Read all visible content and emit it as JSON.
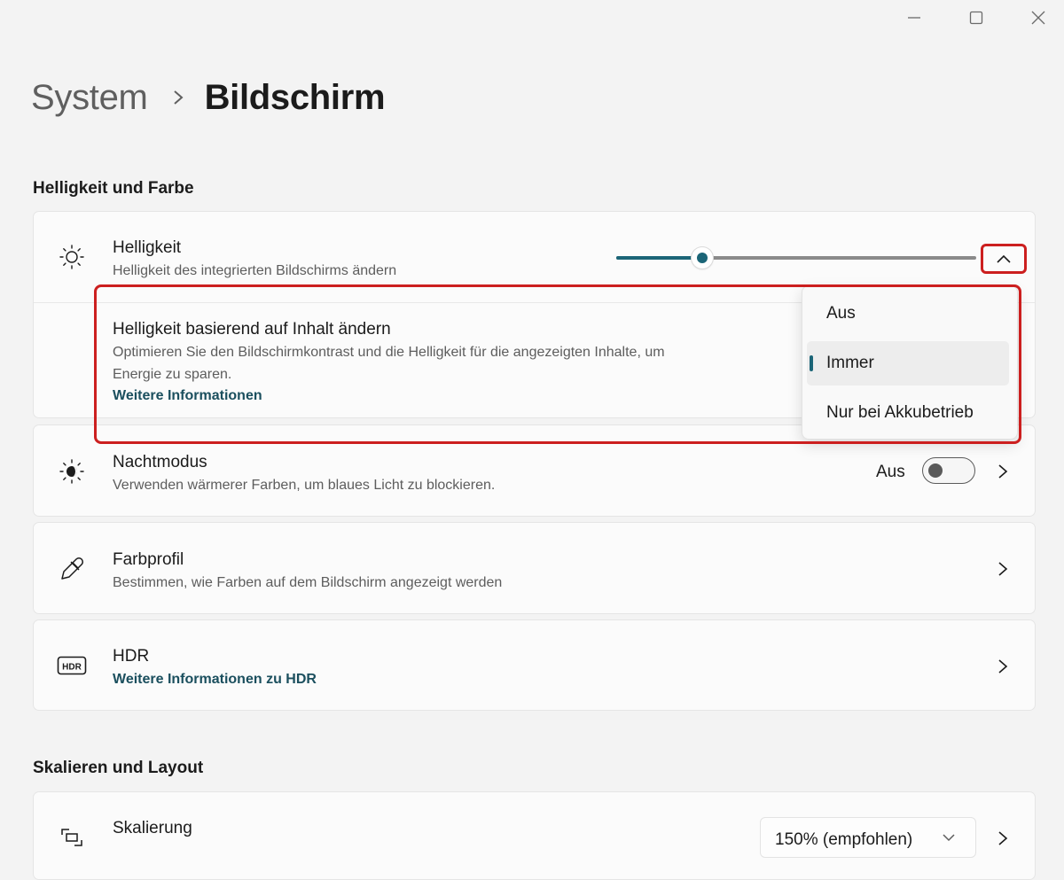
{
  "window": {
    "controls": [
      "minimize-icon",
      "maximize-icon",
      "close-icon"
    ]
  },
  "breadcrumb": {
    "parent": "System",
    "separator_icon": "chevron-right-icon",
    "current": "Bildschirm"
  },
  "sections": {
    "brightness_color": "Helligkeit und Farbe",
    "scale_layout": "Skalieren und Layout"
  },
  "brightness": {
    "icon": "sun-icon",
    "title": "Helligkeit",
    "subtitle": "Helligkeit des integrierten Bildschirms ändern",
    "value_fraction": 0.24,
    "expand_icon": "chevron-up-icon",
    "content_adaptive": {
      "title": "Helligkeit basierend auf Inhalt ändern",
      "description_line1": "Optimieren Sie den Bildschirmkontrast und die Helligkeit für die angezeigten Inhalte, um",
      "description_line2": "Energie zu sparen.",
      "link": "Weitere Informationen"
    },
    "dropdown": {
      "options": [
        "Aus",
        "Immer",
        "Nur bei Akkubetrieb"
      ],
      "selected": "Immer"
    }
  },
  "night_mode": {
    "icon": "night-light-icon",
    "title": "Nachtmodus",
    "subtitle": "Verwenden wärmerer Farben, um blaues Licht zu blockieren.",
    "toggle_label": "Aus",
    "toggle_on": false
  },
  "color_profile": {
    "icon": "eyedropper-icon",
    "title": "Farbprofil",
    "subtitle": "Bestimmen, wie Farben auf dem Bildschirm angezeigt werden"
  },
  "hdr": {
    "icon": "hdr-icon",
    "icon_text": "HDR",
    "title": "HDR",
    "link": "Weitere Informationen zu HDR"
  },
  "scaling": {
    "icon": "scale-icon",
    "title": "Skalierung",
    "value": "150% (empfohlen)"
  },
  "colors": {
    "accent": "#1b6577",
    "highlight": "#cc1f1f",
    "link": "#1b4f5e"
  }
}
